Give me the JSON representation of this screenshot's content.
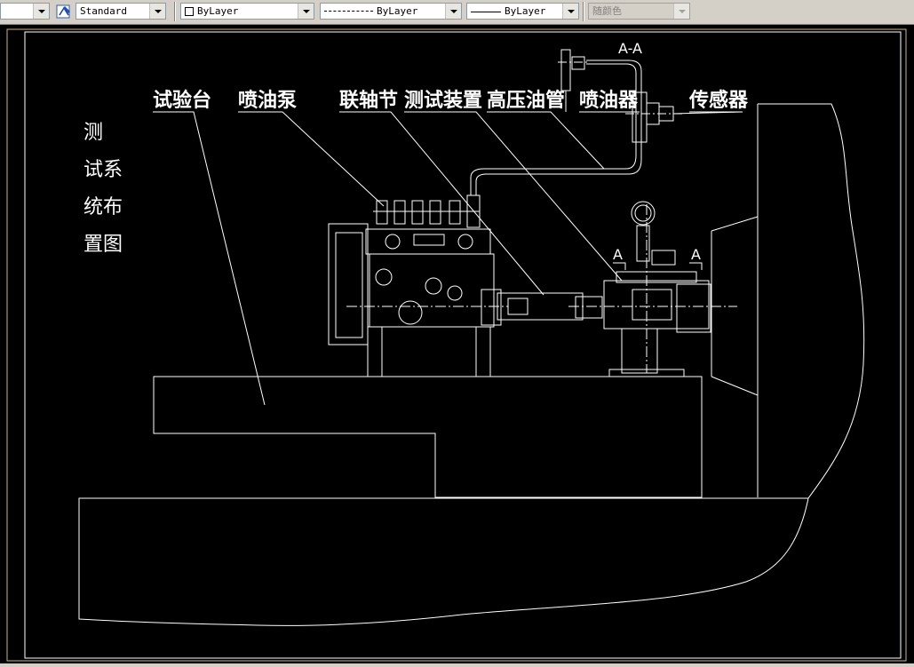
{
  "toolbar": {
    "text_style": "Standard",
    "layer_color": "ByLayer",
    "linetype": "ByLayer",
    "lineweight": "ByLayer",
    "plot_color": "随颜色"
  },
  "drawing": {
    "labels": {
      "test_bench": "试验台",
      "injection_pump": "喷油泵",
      "coupling": "联轴节",
      "test_device": "测试装置",
      "hp_fuel_pipe": "高压油管",
      "injector": "喷油器",
      "sensor": "传感器"
    },
    "title_lines": [
      "测",
      "试系",
      "统布",
      "置图"
    ],
    "section_top": "A-A",
    "section_a_left": "A",
    "section_a_right": "A"
  },
  "colors": {
    "canvas": "#000000",
    "lines": "#ffffff",
    "frame": "#c8b48c"
  }
}
